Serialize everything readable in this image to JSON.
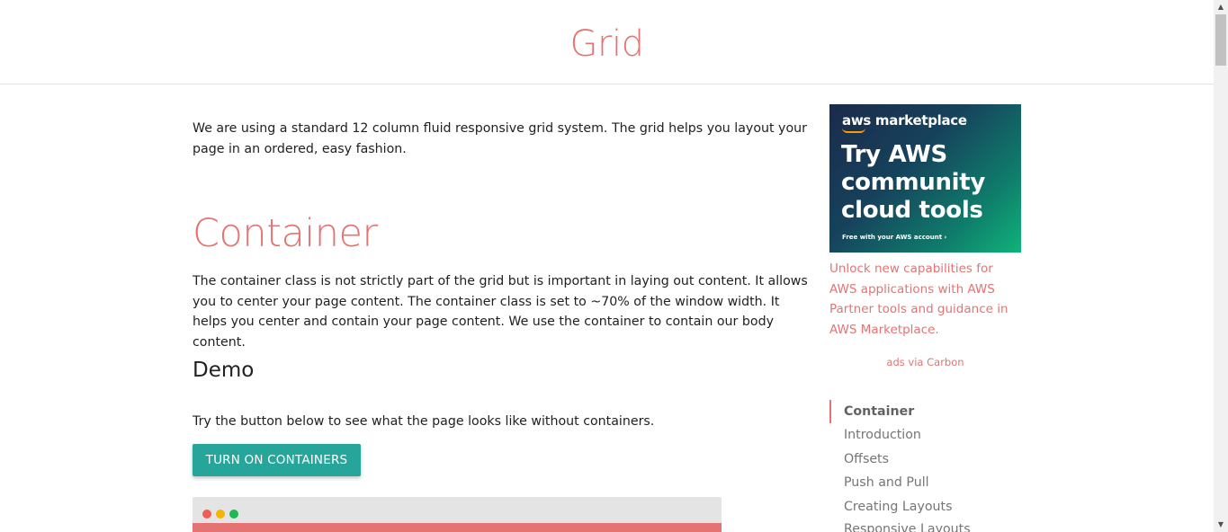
{
  "header": {
    "title": "Grid"
  },
  "main": {
    "intro": "We are using a standard 12 column fluid responsive grid system. The grid helps you layout your page in an ordered, easy fashion.",
    "section_title": "Container",
    "section_desc": "The container class is not strictly part of the grid but is important in laying out content. It allows you to center your page content. The container class is set to ~70% of the window width. It helps you center and contain your page content. We use the container to contain our body content.",
    "demo_title": "Demo",
    "demo_desc": "Try the button below to see what the page looks like without containers.",
    "demo_button": "Turn on Containers"
  },
  "ad": {
    "brand": "aws marketplace",
    "headline": "Try AWS community cloud tools",
    "small": "Free with your AWS account ›",
    "text": "Unlock new capabilities for AWS applications with AWS Partner tools and guidance in AWS Marketplace.",
    "via": "ads via Carbon"
  },
  "toc": {
    "items": [
      {
        "label": "Container"
      },
      {
        "label": "Introduction"
      },
      {
        "label": "Offsets"
      },
      {
        "label": "Push and Pull"
      },
      {
        "label": "Creating Layouts"
      },
      {
        "label": "Responsive Layouts"
      }
    ],
    "active_index": 0
  },
  "colors": {
    "accent": "#e57373",
    "button": "#26a69a"
  },
  "icons": {
    "scroll_up": "scroll-up-arrow-icon",
    "scroll_down": "scroll-down-arrow-icon"
  }
}
